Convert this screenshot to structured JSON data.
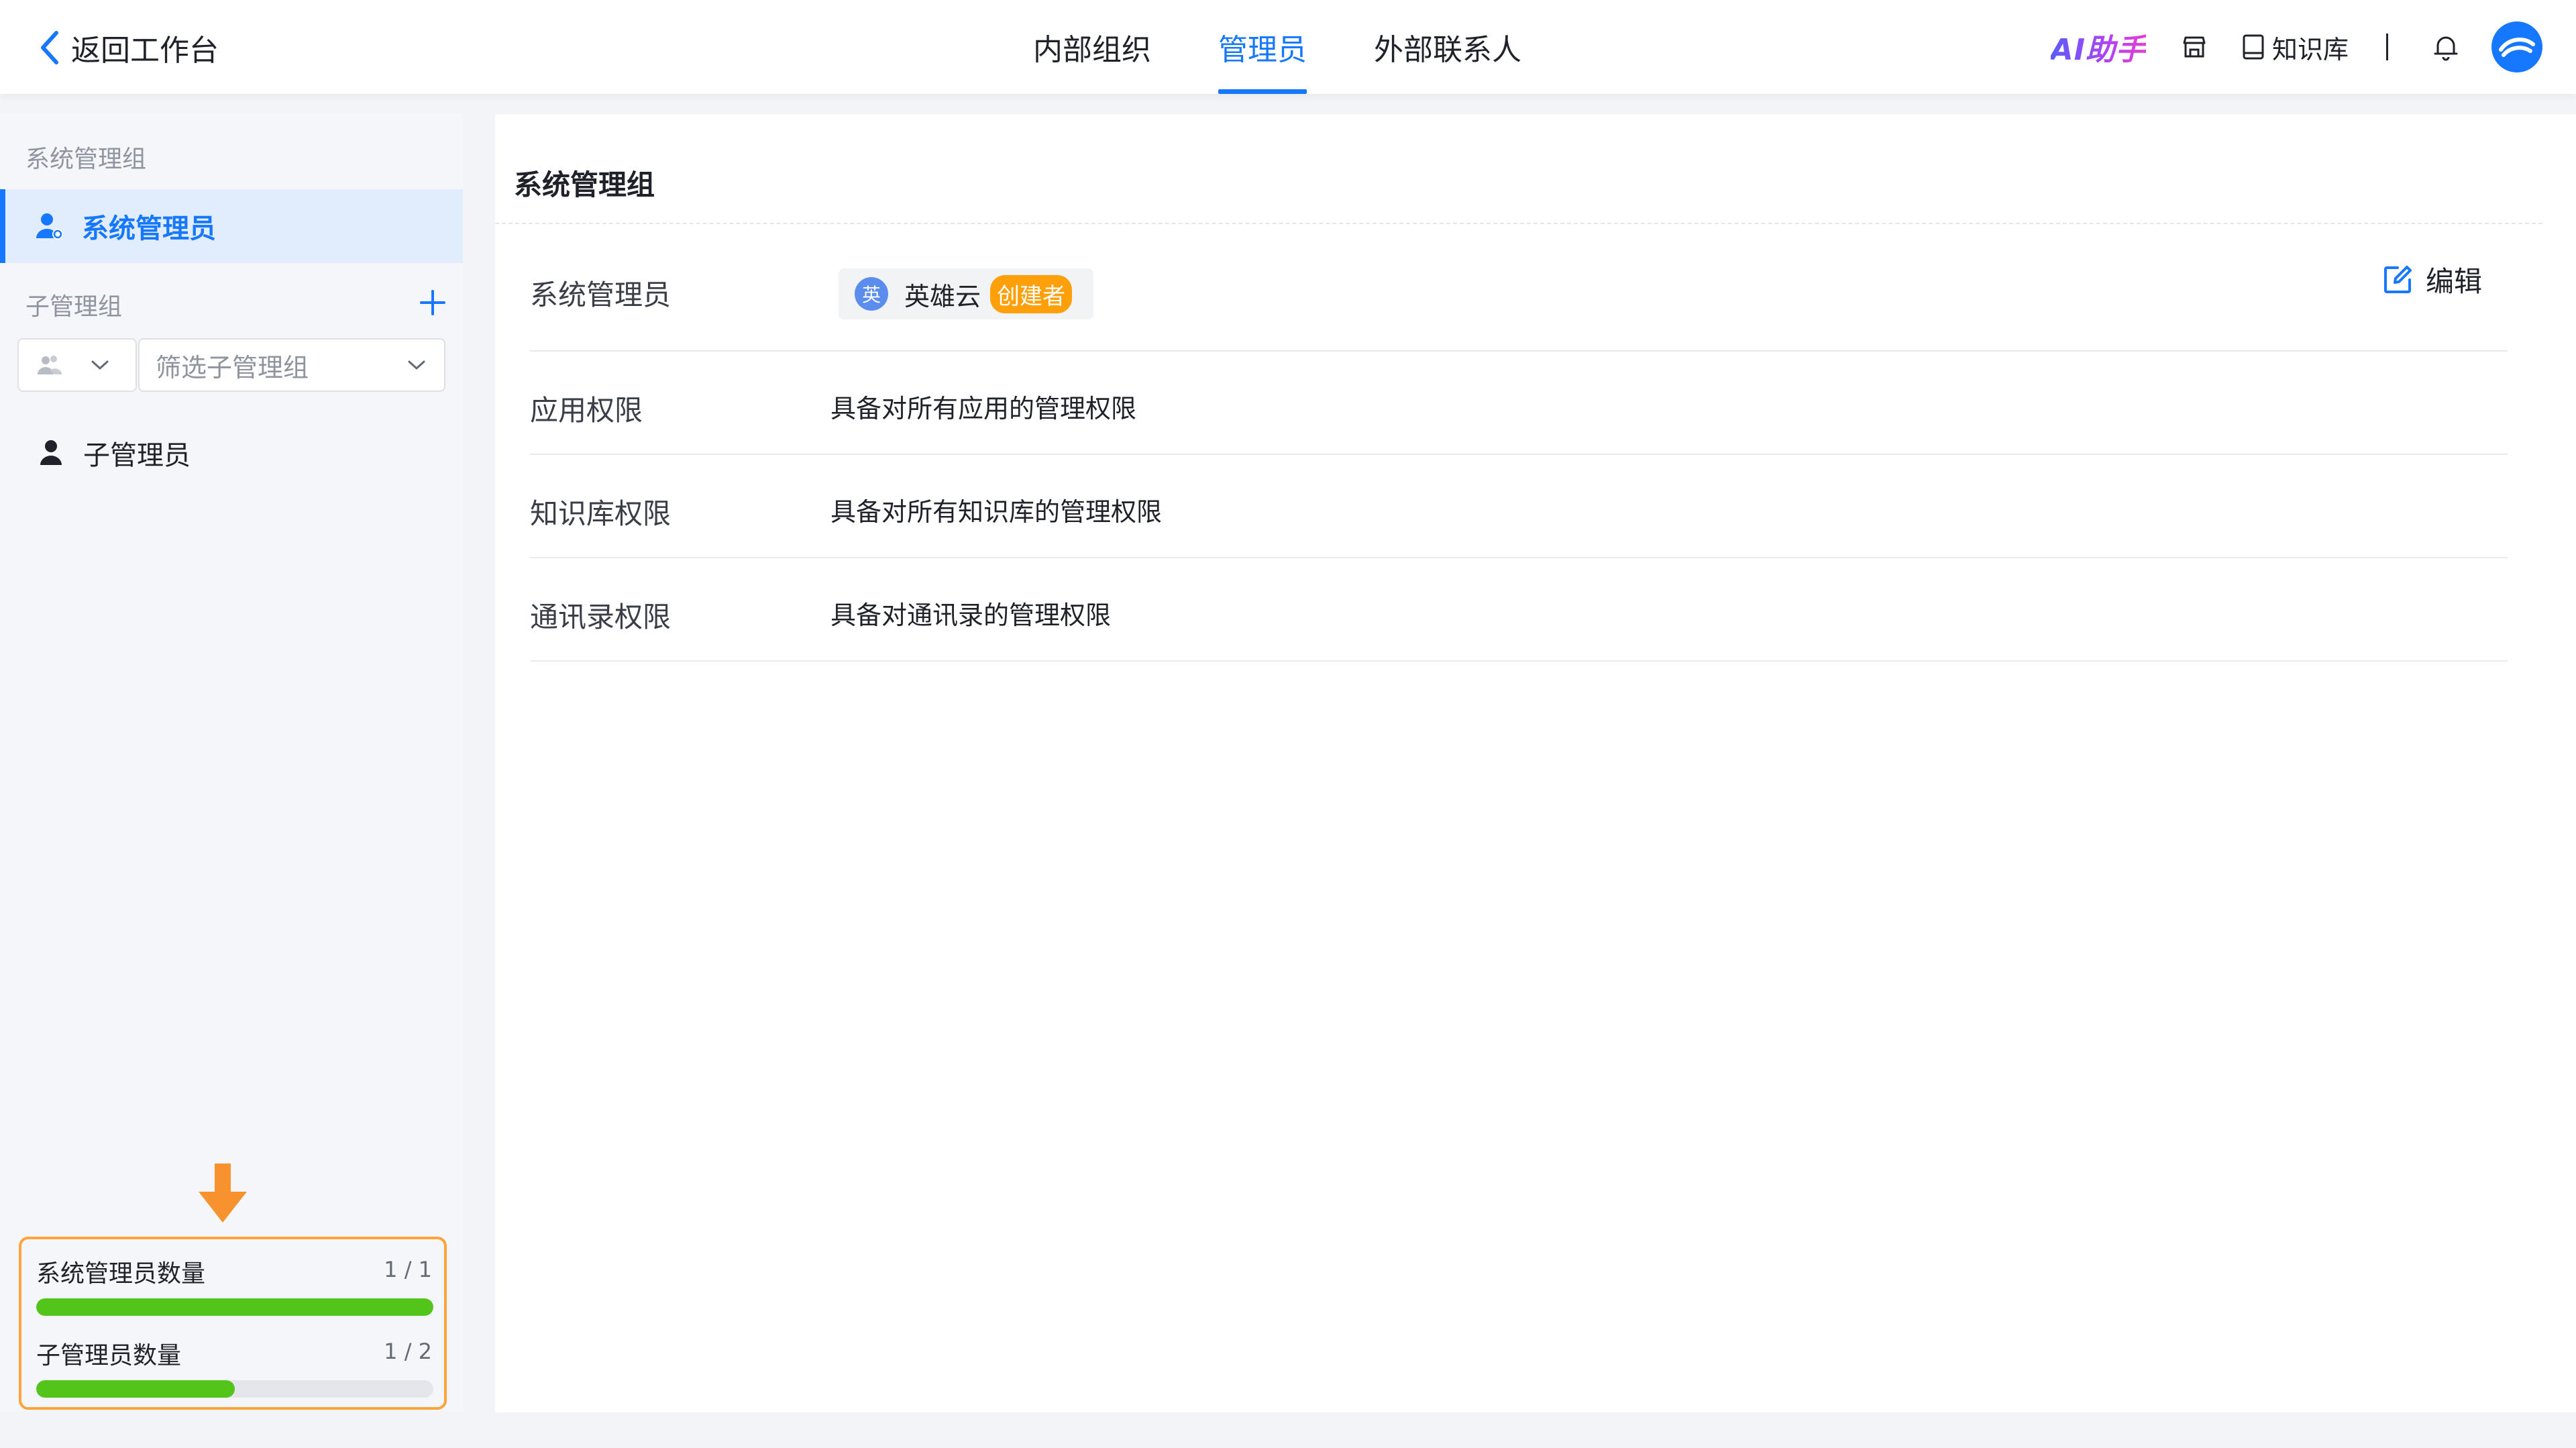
{
  "header": {
    "back_label": "返回工作台",
    "tabs": [
      {
        "label": "内部组织",
        "active": false
      },
      {
        "label": "管理员",
        "active": true
      },
      {
        "label": "外部联系人",
        "active": false
      }
    ],
    "ai_label": "AI助手",
    "kb_label": "知识库",
    "accent_color": "#1677ff"
  },
  "sidebar": {
    "system_group_title": "系统管理组",
    "system_admin_item": "系统管理员",
    "sub_group_title": "子管理组",
    "filter_placeholder": "筛选子管理组",
    "sub_admin_item": "子管理员",
    "quota": {
      "system_admin_label": "系统管理员数量",
      "system_admin_count": "1 / 1",
      "system_admin_ratio": 1.0,
      "sub_admin_label": "子管理员数量",
      "sub_admin_count": "1 / 2",
      "sub_admin_ratio": 0.5
    }
  },
  "main": {
    "title": "系统管理组",
    "edit_label": "编辑",
    "admin_row_label": "系统管理员",
    "admin_user": {
      "avatar_text": "英",
      "name": "英雄云",
      "badge": "创建者"
    },
    "permissions": [
      {
        "label": "应用权限",
        "value": "具备对所有应用的管理权限"
      },
      {
        "label": "知识库权限",
        "value": "具备对所有知识库的管理权限"
      },
      {
        "label": "通讯录权限",
        "value": "具备对通讯录的管理权限"
      }
    ]
  }
}
